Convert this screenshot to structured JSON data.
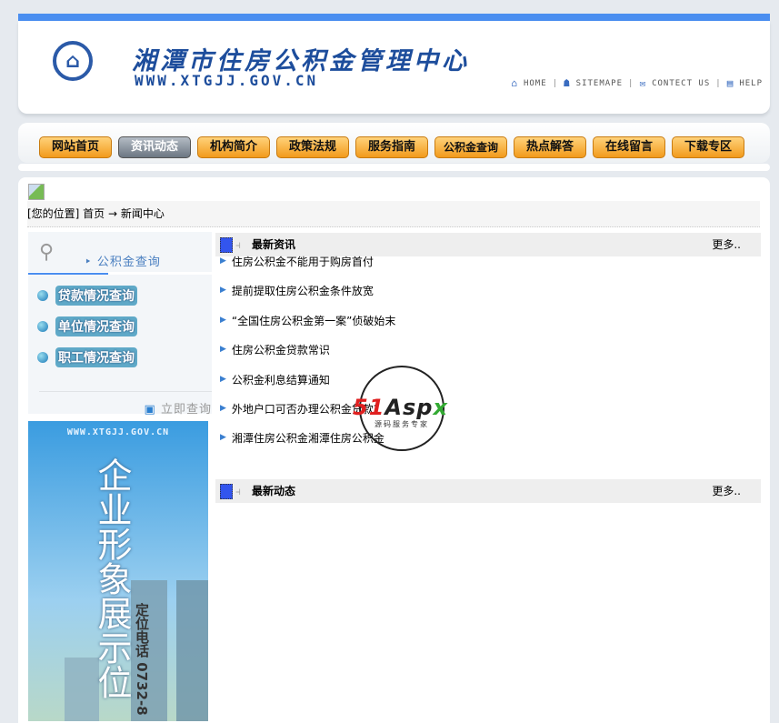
{
  "header": {
    "title": "湘潭市住房公积金管理中心",
    "url": "WWW.XTGJJ.GOV.CN",
    "links": [
      {
        "label": "HOME",
        "icon": "home-icon"
      },
      {
        "label": "SITEMAPE",
        "icon": "sitemap-icon"
      },
      {
        "label": "CONTECT US",
        "icon": "mail-icon"
      },
      {
        "label": "HELP",
        "icon": "help-icon"
      }
    ]
  },
  "nav": {
    "items": [
      "网站首页",
      "资讯动态",
      "机构简介",
      "政策法规",
      "服务指南",
      "公积金查询",
      "热点解答",
      "在线留言",
      "下载专区"
    ],
    "active": 1
  },
  "breadcrumb": "[您的位置] 首页 → 新闻中心",
  "sidebar": {
    "title": "公积金查询",
    "items": [
      "贷款情况查询",
      "单位情况查询",
      "职工情况查询"
    ],
    "query_now": "立即查询"
  },
  "ad": {
    "url": "WWW.XTGJJ.GOV.CN",
    "text": "企业形象展示位",
    "tel": "定位电话 0732-8"
  },
  "latest_news": {
    "title": "最新资讯",
    "more": "更多..",
    "items": [
      "住房公积金不能用于购房首付",
      "提前提取住房公积金条件放宽",
      "“全国住房公积金第一案”侦破始末",
      "住房公积金贷款常识",
      "公积金利息结算通知",
      "外地户口可否办理公积金贷款?",
      "湘潭住房公积金湘潭住房公积金"
    ]
  },
  "latest_updates": {
    "title": "最新动态",
    "more": "更多.."
  },
  "watermark": {
    "brand": "51Aspx",
    "slogan": "源码服务专家"
  },
  "colors": {
    "accent": "#4a8ef0",
    "nav_button": "#f29a1c",
    "nav_active": "#6c7682"
  }
}
